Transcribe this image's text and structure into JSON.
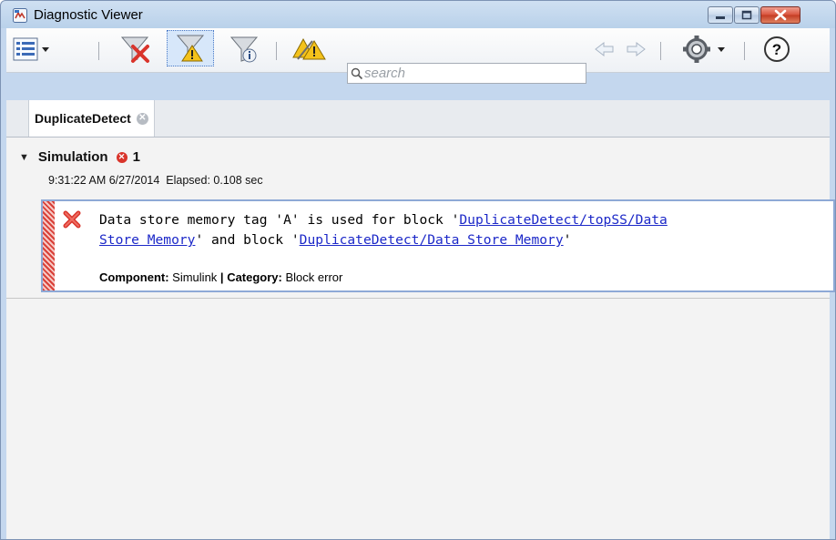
{
  "window": {
    "title": "Diagnostic Viewer",
    "app_icon": "simulink-app-icon"
  },
  "toolbar": {
    "view_menu_icon": "list-view-icon",
    "filter_errors_icon": "filter-errors-icon",
    "filter_warnings_icon": "filter-warnings-icon",
    "filter_info_icon": "filter-info-icon",
    "suppress_warnings_icon": "suppress-warnings-icon",
    "search_placeholder": "search",
    "back_icon": "arrow-left-icon",
    "forward_icon": "arrow-right-icon",
    "settings_icon": "gear-icon",
    "help_icon": "help-icon"
  },
  "tabs": [
    {
      "label": "DuplicateDetect"
    }
  ],
  "simulation": {
    "label": "Simulation",
    "error_count": "1",
    "timestamp": "9:31:22 AM 6/27/2014",
    "elapsed": "Elapsed: 0.108 sec"
  },
  "message": {
    "part1": "Data store memory tag 'A' is used for block '",
    "link1_a": "DuplicateDetect/topSS/Data",
    "link1_b": "Store Memory",
    "part2": "' and block '",
    "link2": "DuplicateDetect/Data Store Memory",
    "part3": "'",
    "component_label": "Component:",
    "component_value": "Simulink",
    "separator": "|",
    "category_label": "Category:",
    "category_value": "Block error"
  },
  "colors": {
    "error": "#d9342b",
    "link": "#1c28c8",
    "panel_border": "#8ea9d6"
  }
}
